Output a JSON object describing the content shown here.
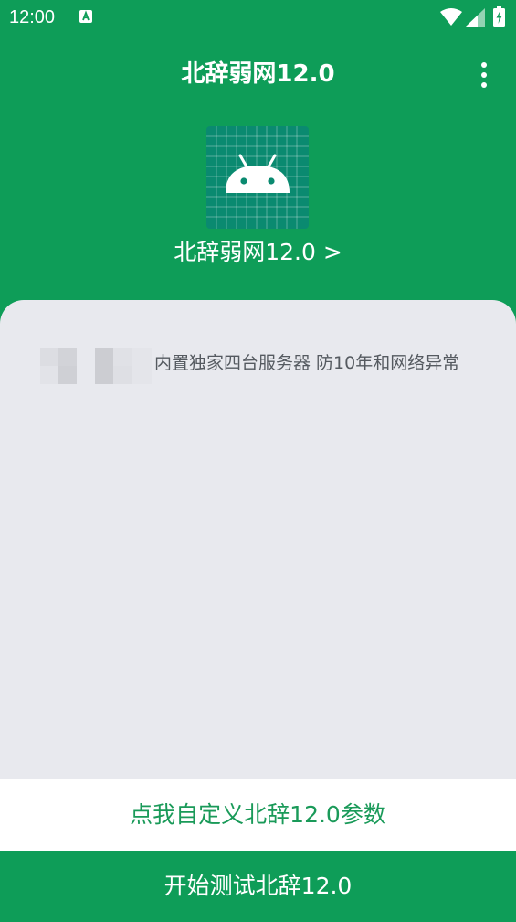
{
  "status_bar": {
    "time": "12:00",
    "icons": [
      "font-a-notification-icon",
      "wifi-icon",
      "cell-signal-icon",
      "battery-charging-icon"
    ]
  },
  "app_bar": {
    "title": "北辞弱网12.0",
    "menu_icon": "more-vert-icon"
  },
  "header": {
    "app_icon": "android-icon",
    "app_name": "北辞弱网12.0 >"
  },
  "notice": {
    "text": "内置独家四台服务器 防10年和网络异常"
  },
  "actions": {
    "custom_label": "点我自定义北辞12.0参数",
    "start_label": "开始测试北辞12.0"
  },
  "colors": {
    "primary": "#0e9d58",
    "icon_bg": "#0a8a70",
    "card_bg": "#e8e9ee",
    "custom_text": "#1a9a59"
  }
}
